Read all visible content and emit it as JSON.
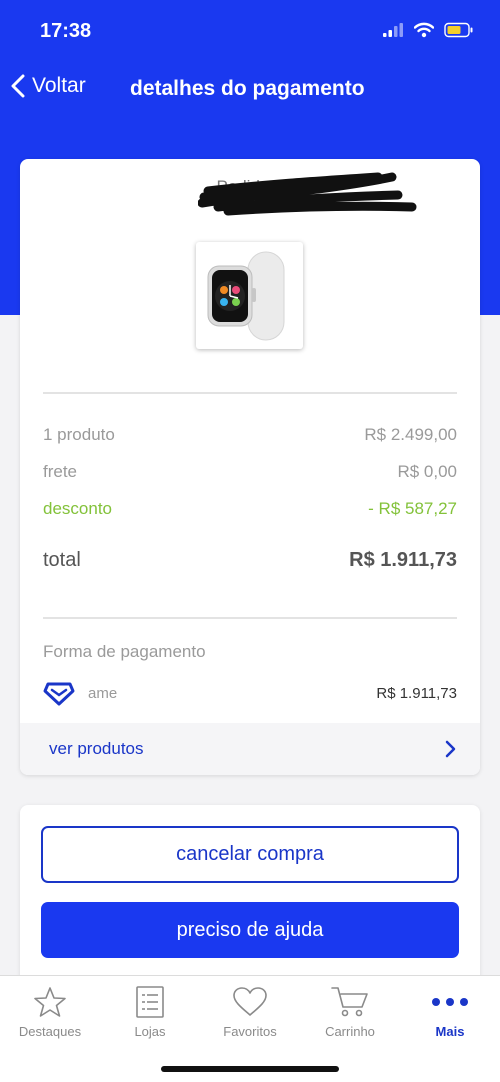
{
  "status_bar": {
    "time": "17:38"
  },
  "nav": {
    "back_label": "Voltar",
    "title": "detalhes do pagamento"
  },
  "order": {
    "label": "Pedido 0",
    "rows": [
      {
        "label": "1 produto",
        "value": "R$ 2.499,00"
      },
      {
        "label": "frete",
        "value": "R$ 0,00"
      },
      {
        "label": "desconto",
        "value": "- R$ 587,27"
      }
    ],
    "total_label": "total",
    "total_value": "R$ 1.911,73"
  },
  "payment": {
    "title": "Forma de pagamento",
    "method": "ame",
    "amount": "R$ 1.911,73"
  },
  "see_products_label": "ver produtos",
  "actions": {
    "cancel_label": "cancelar compra",
    "help_label": "preciso de ajuda"
  },
  "tabs": [
    {
      "label": "Destaques",
      "icon": "star-icon"
    },
    {
      "label": "Lojas",
      "icon": "list-icon"
    },
    {
      "label": "Favoritos",
      "icon": "heart-icon"
    },
    {
      "label": "Carrinho",
      "icon": "cart-icon"
    },
    {
      "label": "Mais",
      "icon": "more-icon",
      "active": true
    }
  ],
  "colors": {
    "brand_blue": "#1a39f0",
    "link_blue": "#1a36c8",
    "discount_green": "#83c23a"
  }
}
